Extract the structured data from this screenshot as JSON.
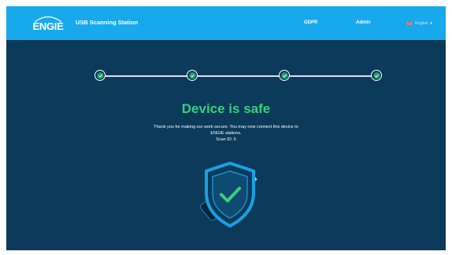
{
  "header": {
    "logo_text": "ENGIE",
    "app_title": "USB Scanning Station",
    "nav": {
      "gdpr": "GDPR",
      "admin": "Admin"
    },
    "language": {
      "label": "English",
      "flag_icon": "uk-flag-icon",
      "chevron_icon": "chevron-down-icon"
    }
  },
  "stepper": {
    "steps": [
      {
        "state": "complete",
        "icon": "check-icon"
      },
      {
        "state": "complete",
        "icon": "check-icon"
      },
      {
        "state": "complete",
        "icon": "check-icon"
      },
      {
        "state": "complete",
        "icon": "check-icon"
      }
    ]
  },
  "result": {
    "headline": "Device is safe",
    "message": "Thank you for making our work secure. You may now connect this device to ENGIE stations.",
    "scan_id": "Scan ID: 5",
    "illustration_icon": "usb-shield-check-icon"
  },
  "colors": {
    "header_bg": "#18a9ec",
    "page_bg": "#0c3a5a",
    "success": "#35d07c",
    "shield": "#1aa0e0"
  }
}
